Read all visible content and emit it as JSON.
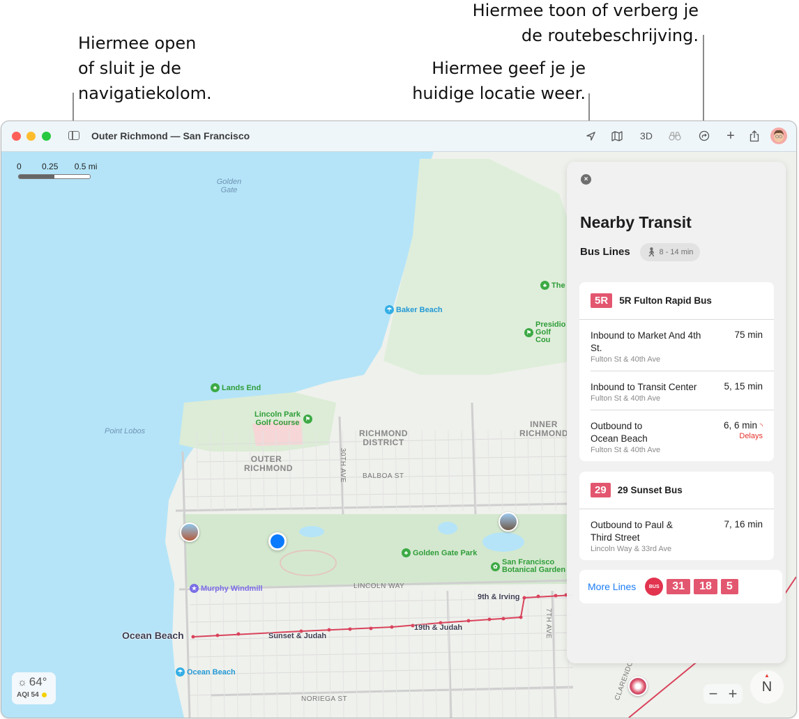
{
  "callouts": {
    "sidebar": [
      "Hiermee open",
      "of sluit je de",
      "navigatiekolom."
    ],
    "location": [
      "Hiermee geef je je",
      "huidige locatie weer."
    ],
    "directions": [
      "Hiermee toon of verberg je",
      "de routebeschrijving."
    ]
  },
  "window": {
    "title": "Outer Richmond — San Francisco",
    "toolbar": {
      "location_icon": "location-arrow-icon",
      "map_icon": "map-icon",
      "three_d_label": "3D",
      "lookaround_icon": "binoculars-icon",
      "directions_icon": "directions-icon",
      "add_icon": "plus-icon",
      "share_icon": "share-icon",
      "avatar_icon": "memoji-avatar-icon"
    }
  },
  "map": {
    "scale": {
      "labels": [
        "0",
        "0.25",
        "0.5 mi"
      ]
    },
    "water_labels": [
      "Golden Gate",
      "Point Lobos"
    ],
    "districts": [
      "OUTER RICHMOND",
      "RICHMOND DISTRICT",
      "INNER RICHMOND"
    ],
    "streets": [
      "30TH AVE",
      "BALBOA ST",
      "LINCOLN WAY",
      "NORIEGA ST",
      "7TH AVE",
      "CLARENDON"
    ],
    "pois": {
      "lands_end": "Lands End",
      "lincoln_park": "Lincoln Park Golf Course",
      "baker_beach": "Baker Beach",
      "the": "The",
      "presidio_golf": "Presidio Golf Cou",
      "golden_gate_park": "Golden Gate Park",
      "botanical": "San Francisco Botanical Garden",
      "murphy": "Murphy Windmill",
      "ocean_beach_poi": "Ocean Beach"
    },
    "stops": {
      "ocean_beach": "Ocean Beach",
      "sunset_judah": "Sunset & Judah",
      "nineteenth_judah": "19th & Judah",
      "ninth_irving": "9th & Irving"
    },
    "route_color": "#d9435c",
    "weather": {
      "temperature": "64°",
      "aqi": "AQI 54",
      "aqi_color": "#f5d100"
    },
    "zoom": {
      "out": "−",
      "in": "+"
    },
    "compass": "N"
  },
  "panel": {
    "close_label": "×",
    "title": "Nearby Transit",
    "section": "Bus Lines",
    "walk_time": "8 - 14 min",
    "lines": [
      {
        "badge": "5R",
        "name": "5R Fulton Rapid Bus",
        "departures": [
          {
            "destination": "Inbound to Market And 4th St.",
            "stop": "Fulton St & 40th Ave",
            "time": "75 min",
            "status": ""
          },
          {
            "destination": "Inbound to Transit Center",
            "stop": "Fulton St & 40th Ave",
            "time": "5, 15 min",
            "status": ""
          },
          {
            "destination": "Outbound to Ocean Beach",
            "stop": "Fulton St & 40th Ave",
            "time": "6, 6 min",
            "status": "Delays"
          }
        ]
      },
      {
        "badge": "29",
        "name": "29 Sunset Bus",
        "departures": [
          {
            "destination": "Outbound to Paul & Third Street",
            "stop": "Lincoln Way & 33rd Ave",
            "time": "7, 16 min",
            "status": ""
          }
        ]
      }
    ],
    "more_lines": {
      "label": "More Lines",
      "bus_icon_text": "BUS",
      "badges": [
        "31",
        "18",
        "5"
      ]
    },
    "badge_color": "#e3566f"
  }
}
